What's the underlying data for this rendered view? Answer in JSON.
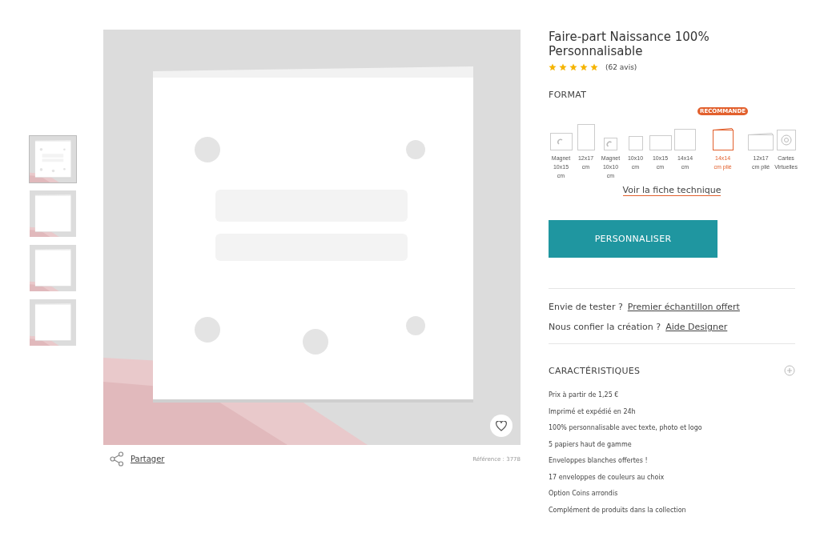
{
  "gallery": {
    "thumbnails": [
      {
        "kind": "picture",
        "selected": true
      },
      {
        "kind": "picture",
        "selected": false
      },
      {
        "kind": "picture",
        "selected": false
      },
      {
        "kind": "picture",
        "selected": false
      }
    ],
    "main_image": {
      "kind": "picture"
    },
    "favorite": {
      "on": false
    },
    "share": "Partager",
    "reference": "Référence : 3778"
  },
  "product": {
    "title": "Faire-part Naissance 100% Personnalisable",
    "stars": 5,
    "reviews": "(62 avis)"
  },
  "format": {
    "heading": "FORMAT",
    "options": [
      {
        "kind": "magnet",
        "label": "Magnet 10x15 cm",
        "selected": false
      },
      {
        "kind": "tall",
        "label": "12x17 cm",
        "selected": false
      },
      {
        "kind": "magnet-small",
        "label": "Magnet 10x10 cm",
        "selected": false
      },
      {
        "kind": "small",
        "label": "10x10 cm",
        "selected": false
      },
      {
        "kind": "wide",
        "label": "10x15 cm",
        "selected": false
      },
      {
        "kind": "square",
        "label": "14x14 cm",
        "selected": false
      },
      {
        "kind": "folded",
        "label": "14x14 cm plié",
        "selected": true,
        "badge": "RECOMMANDE"
      },
      {
        "kind": "wide-folded",
        "label": "12x17 cm plié",
        "selected": false
      },
      {
        "kind": "virtual",
        "label": "Cartes Virtuelles",
        "selected": false
      }
    ],
    "link": "Voir la fiche technique"
  },
  "cta": "PERSONNALISER",
  "offers": [
    {
      "text": "Envie de tester ?",
      "link": "Premier échantillon offert"
    },
    {
      "text": "Nous confier la création ?",
      "link": "Aide Designer"
    }
  ],
  "features": {
    "heading": "CARACTÉRISTIQUES",
    "expanded": false,
    "items": [
      "Prix à partir de 1,25 €",
      "Imprimé et expédié en 24h",
      "100% personnalisable avec texte, photo et logo",
      "5 papiers haut de gamme",
      "Enveloppes blanches offertes !",
      "17 enveloppes de couleurs au choix",
      "Option Coins arrondis",
      "Complément de produits dans la collection"
    ]
  }
}
